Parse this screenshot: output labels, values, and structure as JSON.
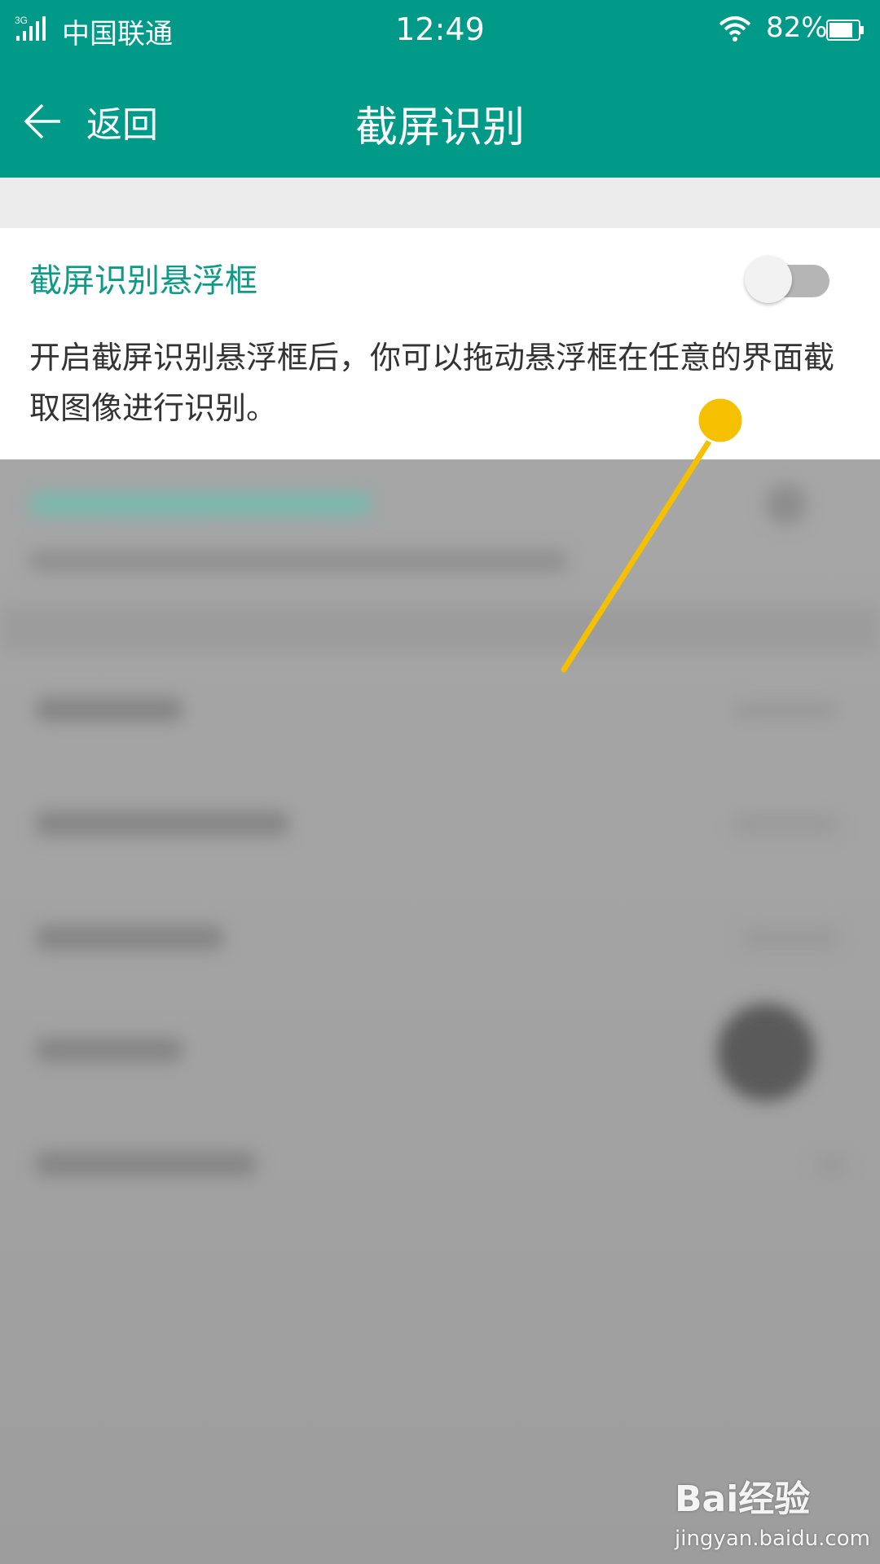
{
  "status_bar": {
    "network": "3G",
    "carrier": "中国联通",
    "time": "12:49",
    "battery": "82%"
  },
  "header": {
    "back_label": "返回",
    "title": "截屏识别"
  },
  "setting": {
    "title": "截屏识别悬浮框",
    "enabled": false,
    "description": "开启截屏识别悬浮框后，你可以拖动悬浮框在任意的界面截取图像进行识别。"
  },
  "watermark": {
    "brand": "Bai经验",
    "url": "jingyan.baidu.com"
  },
  "colors": {
    "header": "#019a88",
    "accent": "#0f9a88",
    "annotation": "#f5c000"
  }
}
